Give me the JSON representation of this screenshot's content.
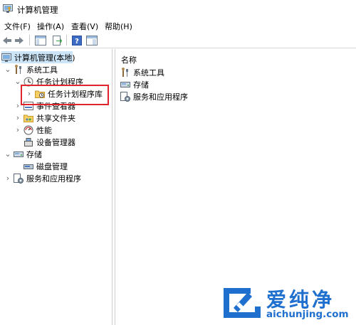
{
  "window": {
    "title": "计算机管理"
  },
  "menu": {
    "file": "文件(F)",
    "action": "操作(A)",
    "view": "查看(V)",
    "help": "帮助(H)"
  },
  "toolbar": {
    "icons": [
      "back-arrow",
      "forward-arrow",
      "show-hide-console-tree",
      "export-list",
      "help",
      "properties-pane"
    ]
  },
  "tree": {
    "root": "计算机管理(本地)",
    "system_tools": "系统工具",
    "task_scheduler": "任务计划程序",
    "task_scheduler_library": "任务计划程序库",
    "event_viewer": "事件查看器",
    "shared_folders": "共享文件夹",
    "performance": "性能",
    "device_manager": "设备管理器",
    "storage": "存储",
    "disk_management": "磁盘管理",
    "services_apps": "服务和应用程序"
  },
  "list": {
    "header_name": "名称",
    "items": [
      "系统工具",
      "存储",
      "服务和应用程序"
    ]
  },
  "watermark": {
    "brand": "爱纯净",
    "url": "aichunjing.com"
  },
  "colors": {
    "annotation_red": "#e0242b",
    "selection_blue": "#cce4f7",
    "watermark_blue": "#1f6fcf"
  }
}
